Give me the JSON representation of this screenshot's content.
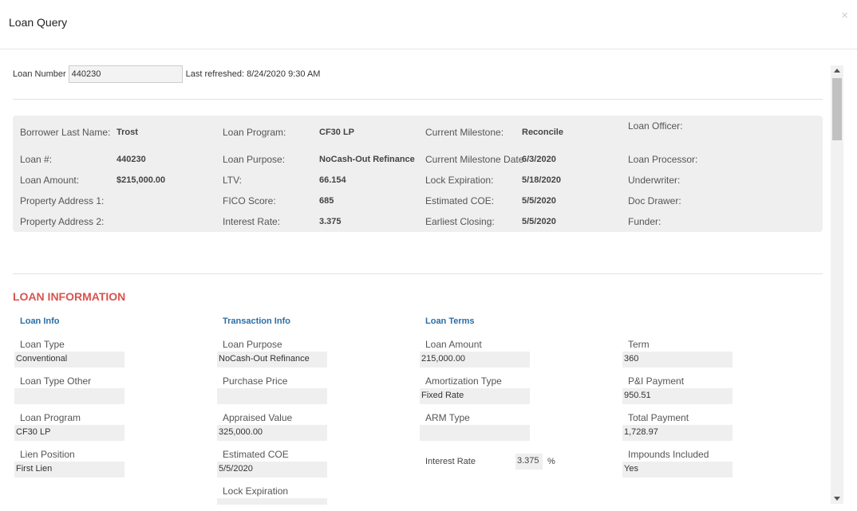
{
  "modal": {
    "title": "Loan Query",
    "close": "×"
  },
  "search": {
    "label": "Loan Number",
    "value": "440230",
    "last_refreshed": "Last refreshed: 8/24/2020 9:30 AM"
  },
  "summary": {
    "borrower_last_name": {
      "label": "Borrower Last Name:",
      "value": "Trost"
    },
    "loan_program": {
      "label": "Loan Program:",
      "value": "CF30 LP"
    },
    "current_milestone": {
      "label": "Current Milestone:",
      "value": "Reconcile"
    },
    "loan_officer": {
      "label": "Loan Officer:",
      "value": ""
    },
    "loan_num": {
      "label": "Loan #:",
      "value": "440230"
    },
    "loan_purpose": {
      "label": "Loan Purpose:",
      "value": "NoCash-Out Refinance"
    },
    "current_milestone_date": {
      "label": "Current Milestone Date",
      "value": "6/3/2020"
    },
    "loan_processor": {
      "label": "Loan Processor:",
      "value": ""
    },
    "loan_amount": {
      "label": "Loan Amount:",
      "value": "$215,000.00"
    },
    "ltv": {
      "label": "LTV:",
      "value": "66.154"
    },
    "lock_expiration": {
      "label": "Lock Expiration:",
      "value": "5/18/2020"
    },
    "underwriter": {
      "label": "Underwriter:",
      "value": ""
    },
    "property_address_1": {
      "label": "Property Address 1:",
      "value": ""
    },
    "fico_score": {
      "label": "FICO Score:",
      "value": "685"
    },
    "estimated_coe": {
      "label": "Estimated COE:",
      "value": "5/5/2020"
    },
    "doc_drawer": {
      "label": "Doc Drawer:",
      "value": ""
    },
    "property_address_2": {
      "label": "Property Address 2:",
      "value": ""
    },
    "interest_rate": {
      "label": "Interest Rate:",
      "value": "3.375"
    },
    "earliest_closing": {
      "label": "Earliest Closing:",
      "value": "5/5/2020"
    },
    "funder": {
      "label": "Funder:",
      "value": ""
    }
  },
  "loan_information": {
    "title": "LOAN INFORMATION",
    "loan_info": {
      "heading": "Loan Info",
      "loan_type": {
        "label": "Loan Type",
        "value": "Conventional"
      },
      "loan_type_other": {
        "label": "Loan Type Other",
        "value": ""
      },
      "loan_program": {
        "label": "Loan Program",
        "value": "CF30 LP"
      },
      "lien_position": {
        "label": "Lien Position",
        "value": "First Lien"
      }
    },
    "transaction_info": {
      "heading": "Transaction Info",
      "loan_purpose": {
        "label": "Loan Purpose",
        "value": "NoCash-Out Refinance"
      },
      "purchase_price": {
        "label": "Purchase Price",
        "value": ""
      },
      "appraised_value": {
        "label": "Appraised Value",
        "value": "325,000.00"
      },
      "estimated_coe": {
        "label": "Estimated COE",
        "value": "5/5/2020"
      },
      "lock_expiration": {
        "label": "Lock Expiration",
        "value": ""
      }
    },
    "loan_terms": {
      "heading": "Loan Terms",
      "loan_amount": {
        "label": "Loan Amount",
        "value": "215,000.00"
      },
      "amortization_type": {
        "label": "Amortization Type",
        "value": "Fixed Rate"
      },
      "arm_type": {
        "label": "ARM Type",
        "value": ""
      },
      "interest_rate": {
        "label": "Interest Rate",
        "value": "3.375",
        "unit": "%"
      }
    },
    "payment": {
      "term": {
        "label": "Term",
        "value": "360"
      },
      "pi_payment": {
        "label": "P&I Payment",
        "value": "950.51"
      },
      "total_payment": {
        "label": "Total Payment",
        "value": "1,728.97"
      },
      "impounds_included": {
        "label": "Impounds Included",
        "value": "Yes"
      }
    }
  }
}
